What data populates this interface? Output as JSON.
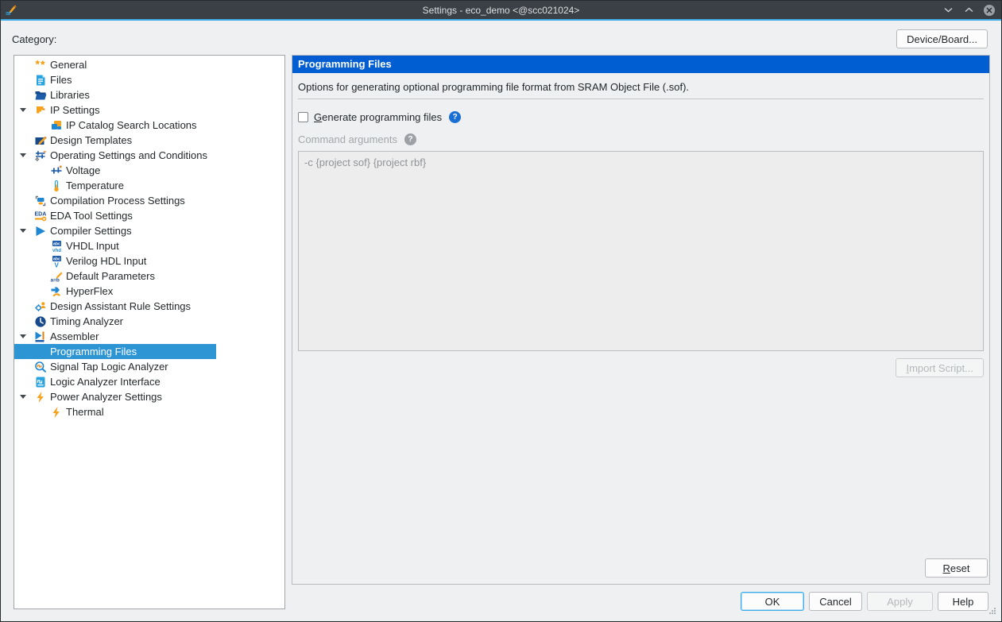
{
  "window": {
    "title": "Settings - eco_demo <@scc021024>"
  },
  "titlebar": {
    "app_icon": "quartus-settings",
    "controls": {
      "shade": "chevron-down",
      "unshade": "chevron-up",
      "close": "close"
    }
  },
  "toolbar": {
    "category_label": "Category:",
    "device_board_button": "Device/Board..."
  },
  "tree": {
    "items": [
      {
        "label": "General",
        "icon": "general-stars",
        "level": 1
      },
      {
        "label": "Files",
        "icon": "files-document",
        "level": 1
      },
      {
        "label": "Libraries",
        "icon": "libraries-folder",
        "level": 1
      },
      {
        "label": "IP Settings",
        "icon": "ip-settings-flag",
        "level": 1,
        "expanded": true
      },
      {
        "label": "IP Catalog Search Locations",
        "icon": "ip-catalog",
        "level": 2
      },
      {
        "label": "Design Templates",
        "icon": "design-templates",
        "level": 1
      },
      {
        "label": "Operating Settings and Conditions",
        "icon": "operating-conditions",
        "level": 1,
        "expanded": true
      },
      {
        "label": "Voltage",
        "icon": "voltage-slider",
        "level": 2
      },
      {
        "label": "Temperature",
        "icon": "temperature-thermometer",
        "level": 2
      },
      {
        "label": "Compilation Process Settings",
        "icon": "compilation-process",
        "level": 1
      },
      {
        "label": "EDA Tool Settings",
        "icon": "eda-tool",
        "level": 1
      },
      {
        "label": "Compiler Settings",
        "icon": "compiler-play",
        "level": 1,
        "expanded": true
      },
      {
        "label": "VHDL Input",
        "icon": "vhdl-input",
        "level": 2
      },
      {
        "label": "Verilog HDL Input",
        "icon": "verilog-input",
        "level": 2
      },
      {
        "label": "Default Parameters",
        "icon": "default-parameters",
        "level": 2
      },
      {
        "label": "HyperFlex",
        "icon": "hyperflex",
        "level": 2
      },
      {
        "label": "Design Assistant Rule Settings",
        "icon": "design-assistant",
        "level": 1
      },
      {
        "label": "Timing Analyzer",
        "icon": "timing-clock",
        "level": 1
      },
      {
        "label": "Assembler",
        "icon": "assembler",
        "level": 1,
        "expanded": true
      },
      {
        "label": "Programming Files",
        "icon": null,
        "level": 2,
        "selected": true
      },
      {
        "label": "Signal Tap Logic Analyzer",
        "icon": "signal-tap",
        "level": 1
      },
      {
        "label": "Logic Analyzer Interface",
        "icon": "logic-analyzer",
        "level": 1
      },
      {
        "label": "Power Analyzer Settings",
        "icon": "power-lightning",
        "level": 1,
        "expanded": true
      },
      {
        "label": "Thermal",
        "icon": "thermal-lightning",
        "level": 2
      }
    ]
  },
  "panel": {
    "title": "Programming Files",
    "description": "Options for generating optional programming file format from SRAM Object File (.sof).",
    "generate_checkbox": {
      "label": "Generate programming files",
      "checked": false,
      "accel": "G"
    },
    "command_arguments": {
      "label": "Command arguments",
      "value": "-c {project sof} {project rbf}",
      "enabled": false
    },
    "import_script_button": {
      "label": "Import Script...",
      "enabled": false,
      "accel": "I"
    },
    "reset_button": {
      "label": "Reset",
      "enabled": true,
      "accel": "R"
    }
  },
  "footer": {
    "ok_button": "OK",
    "cancel_button": "Cancel",
    "apply_button": "Apply",
    "apply_enabled": false,
    "help_button": "Help"
  },
  "icons": {
    "help_glyph": "?"
  },
  "colors": {
    "accent_blue": "#3daee9",
    "panel_header_blue": "#005ed2",
    "selection_blue": "#2e95d4",
    "titlebar_gray": "#3a4045",
    "highlight_orange": "#f6a21d"
  }
}
